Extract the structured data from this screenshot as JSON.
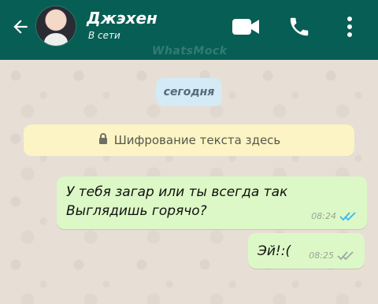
{
  "header": {
    "contact_name": "Джэхен",
    "status": "В сети",
    "watermark": "WhatsMock",
    "icons": [
      "back-arrow-icon",
      "video-call-icon",
      "phone-icon",
      "more-vert-icon"
    ],
    "colors": {
      "header_bg": "#075e54",
      "text": "#ffffff"
    }
  },
  "chat": {
    "date_label": "сегодня",
    "encryption_notice": "Шифрование текста здесь",
    "messages": [
      {
        "text": "У тебя загар или ты всегда так\nВыглядишь горячо?",
        "time": "08:24",
        "status": "read"
      },
      {
        "text": "Эй!:(",
        "time": "08:25",
        "status": "delivered"
      }
    ]
  }
}
